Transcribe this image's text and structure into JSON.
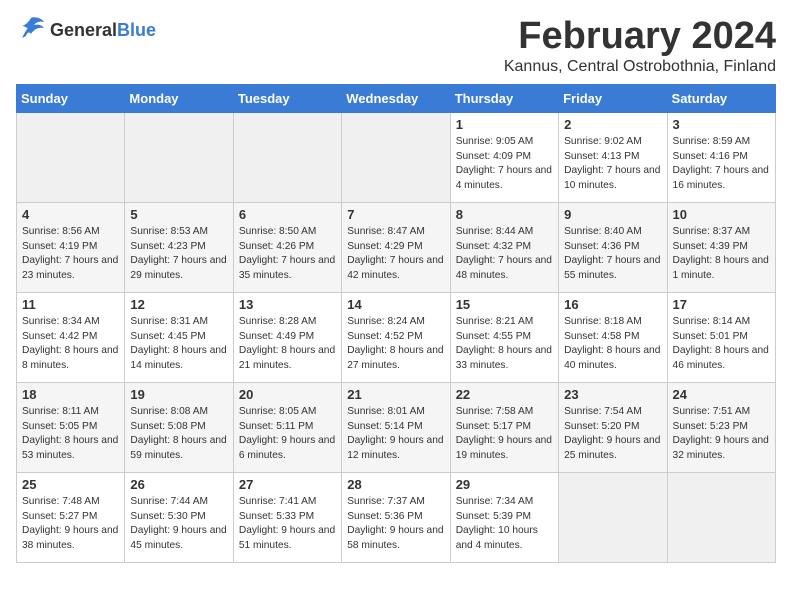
{
  "header": {
    "logo_general": "General",
    "logo_blue": "Blue",
    "month_title": "February 2024",
    "location": "Kannus, Central Ostrobothnia, Finland"
  },
  "weekdays": [
    "Sunday",
    "Monday",
    "Tuesday",
    "Wednesday",
    "Thursday",
    "Friday",
    "Saturday"
  ],
  "weeks": [
    [
      {
        "day": "",
        "empty": true
      },
      {
        "day": "",
        "empty": true
      },
      {
        "day": "",
        "empty": true
      },
      {
        "day": "",
        "empty": true
      },
      {
        "day": "1",
        "sunrise": "9:05 AM",
        "sunset": "4:09 PM",
        "daylight": "7 hours and 4 minutes."
      },
      {
        "day": "2",
        "sunrise": "9:02 AM",
        "sunset": "4:13 PM",
        "daylight": "7 hours and 10 minutes."
      },
      {
        "day": "3",
        "sunrise": "8:59 AM",
        "sunset": "4:16 PM",
        "daylight": "7 hours and 16 minutes."
      }
    ],
    [
      {
        "day": "4",
        "sunrise": "8:56 AM",
        "sunset": "4:19 PM",
        "daylight": "7 hours and 23 minutes."
      },
      {
        "day": "5",
        "sunrise": "8:53 AM",
        "sunset": "4:23 PM",
        "daylight": "7 hours and 29 minutes."
      },
      {
        "day": "6",
        "sunrise": "8:50 AM",
        "sunset": "4:26 PM",
        "daylight": "7 hours and 35 minutes."
      },
      {
        "day": "7",
        "sunrise": "8:47 AM",
        "sunset": "4:29 PM",
        "daylight": "7 hours and 42 minutes."
      },
      {
        "day": "8",
        "sunrise": "8:44 AM",
        "sunset": "4:32 PM",
        "daylight": "7 hours and 48 minutes."
      },
      {
        "day": "9",
        "sunrise": "8:40 AM",
        "sunset": "4:36 PM",
        "daylight": "7 hours and 55 minutes."
      },
      {
        "day": "10",
        "sunrise": "8:37 AM",
        "sunset": "4:39 PM",
        "daylight": "8 hours and 1 minute."
      }
    ],
    [
      {
        "day": "11",
        "sunrise": "8:34 AM",
        "sunset": "4:42 PM",
        "daylight": "8 hours and 8 minutes."
      },
      {
        "day": "12",
        "sunrise": "8:31 AM",
        "sunset": "4:45 PM",
        "daylight": "8 hours and 14 minutes."
      },
      {
        "day": "13",
        "sunrise": "8:28 AM",
        "sunset": "4:49 PM",
        "daylight": "8 hours and 21 minutes."
      },
      {
        "day": "14",
        "sunrise": "8:24 AM",
        "sunset": "4:52 PM",
        "daylight": "8 hours and 27 minutes."
      },
      {
        "day": "15",
        "sunrise": "8:21 AM",
        "sunset": "4:55 PM",
        "daylight": "8 hours and 33 minutes."
      },
      {
        "day": "16",
        "sunrise": "8:18 AM",
        "sunset": "4:58 PM",
        "daylight": "8 hours and 40 minutes."
      },
      {
        "day": "17",
        "sunrise": "8:14 AM",
        "sunset": "5:01 PM",
        "daylight": "8 hours and 46 minutes."
      }
    ],
    [
      {
        "day": "18",
        "sunrise": "8:11 AM",
        "sunset": "5:05 PM",
        "daylight": "8 hours and 53 minutes."
      },
      {
        "day": "19",
        "sunrise": "8:08 AM",
        "sunset": "5:08 PM",
        "daylight": "8 hours and 59 minutes."
      },
      {
        "day": "20",
        "sunrise": "8:05 AM",
        "sunset": "5:11 PM",
        "daylight": "9 hours and 6 minutes."
      },
      {
        "day": "21",
        "sunrise": "8:01 AM",
        "sunset": "5:14 PM",
        "daylight": "9 hours and 12 minutes."
      },
      {
        "day": "22",
        "sunrise": "7:58 AM",
        "sunset": "5:17 PM",
        "daylight": "9 hours and 19 minutes."
      },
      {
        "day": "23",
        "sunrise": "7:54 AM",
        "sunset": "5:20 PM",
        "daylight": "9 hours and 25 minutes."
      },
      {
        "day": "24",
        "sunrise": "7:51 AM",
        "sunset": "5:23 PM",
        "daylight": "9 hours and 32 minutes."
      }
    ],
    [
      {
        "day": "25",
        "sunrise": "7:48 AM",
        "sunset": "5:27 PM",
        "daylight": "9 hours and 38 minutes."
      },
      {
        "day": "26",
        "sunrise": "7:44 AM",
        "sunset": "5:30 PM",
        "daylight": "9 hours and 45 minutes."
      },
      {
        "day": "27",
        "sunrise": "7:41 AM",
        "sunset": "5:33 PM",
        "daylight": "9 hours and 51 minutes."
      },
      {
        "day": "28",
        "sunrise": "7:37 AM",
        "sunset": "5:36 PM",
        "daylight": "9 hours and 58 minutes."
      },
      {
        "day": "29",
        "sunrise": "7:34 AM",
        "sunset": "5:39 PM",
        "daylight": "10 hours and 4 minutes."
      },
      {
        "day": "",
        "empty": true
      },
      {
        "day": "",
        "empty": true
      }
    ]
  ],
  "labels": {
    "sunrise_prefix": "Sunrise: ",
    "sunset_prefix": "Sunset: ",
    "daylight_prefix": "Daylight: "
  }
}
